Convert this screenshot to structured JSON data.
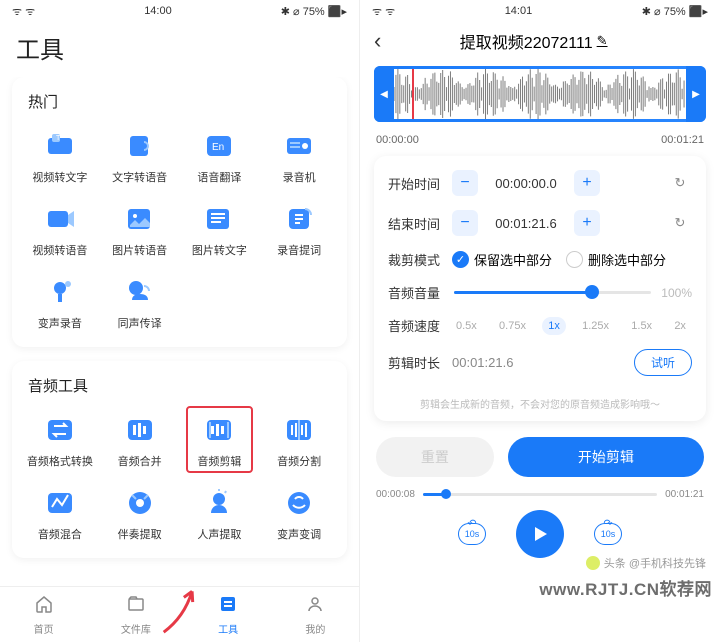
{
  "left": {
    "status": {
      "time": "14:00",
      "right": "✱ ⌀ 75% ⬛▸",
      "wifi": "ᯤ ᯤ"
    },
    "page_title": "工具",
    "sections": [
      {
        "title": "热门",
        "items": [
          {
            "label": "视频转文字",
            "iconName": "video-to-text-icon"
          },
          {
            "label": "文字转语音",
            "iconName": "text-to-audio-icon"
          },
          {
            "label": "语音翻译",
            "iconName": "voice-translate-icon"
          },
          {
            "label": "录音机",
            "iconName": "recorder-icon"
          },
          {
            "label": "视频转语音",
            "iconName": "video-to-audio-icon"
          },
          {
            "label": "图片转语音",
            "iconName": "image-to-audio-icon"
          },
          {
            "label": "图片转文字",
            "iconName": "image-to-text-icon"
          },
          {
            "label": "录音提词",
            "iconName": "prompter-icon"
          },
          {
            "label": "变声录音",
            "iconName": "voice-change-record-icon"
          },
          {
            "label": "同声传译",
            "iconName": "interpret-icon"
          }
        ]
      },
      {
        "title": "音频工具",
        "items": [
          {
            "label": "音频格式转换",
            "iconName": "audio-convert-icon"
          },
          {
            "label": "音频合并",
            "iconName": "audio-merge-icon"
          },
          {
            "label": "音频剪辑",
            "iconName": "audio-trim-icon",
            "highlighted": true
          },
          {
            "label": "音频分割",
            "iconName": "audio-split-icon"
          },
          {
            "label": "音频混合",
            "iconName": "audio-mix-icon"
          },
          {
            "label": "伴奏提取",
            "iconName": "accompaniment-icon"
          },
          {
            "label": "人声提取",
            "iconName": "vocals-icon"
          },
          {
            "label": "变声变调",
            "iconName": "pitch-shift-icon"
          }
        ]
      }
    ],
    "nav": [
      {
        "label": "首页",
        "iconName": "home-icon"
      },
      {
        "label": "文件库",
        "iconName": "files-icon"
      },
      {
        "label": "工具",
        "iconName": "tools-icon",
        "active": true
      },
      {
        "label": "我的",
        "iconName": "profile-icon"
      }
    ]
  },
  "right": {
    "status": {
      "time": "14:01",
      "right": "✱ ⌀ 75% ⬛▸",
      "wifi": "ᯤ ᯤ"
    },
    "title": "提取视频22072111",
    "time_start_display": "00:00:00",
    "time_end_display": "00:01:21",
    "start_label": "开始时间",
    "start_value": "00:00:00.0",
    "end_label": "结束时间",
    "end_value": "00:01:21.6",
    "trim_mode_label": "裁剪模式",
    "trim_keep": "保留选中部分",
    "trim_delete": "删除选中部分",
    "volume_label": "音频音量",
    "volume_value": "100%",
    "volume_percent": 70,
    "speed_label": "音频速度",
    "speeds": [
      "0.5x",
      "0.75x",
      "1x",
      "1.25x",
      "1.5x",
      "2x"
    ],
    "speed_selected": "1x",
    "duration_label": "剪辑时长",
    "duration_value": "00:01:21.6",
    "preview_label": "试听",
    "hint": "剪辑会生成新的音频，不会对您的原音频造成影响哦～",
    "reset_label": "重置",
    "start_btn_label": "开始剪辑",
    "progress_current": "00:00:08",
    "progress_total": "00:01:21",
    "rewind_label": "10s",
    "forward_label": "10s"
  },
  "watermark": "www.RJTJ.CN软荐网",
  "attribution": "头条 @手机科技先锋"
}
